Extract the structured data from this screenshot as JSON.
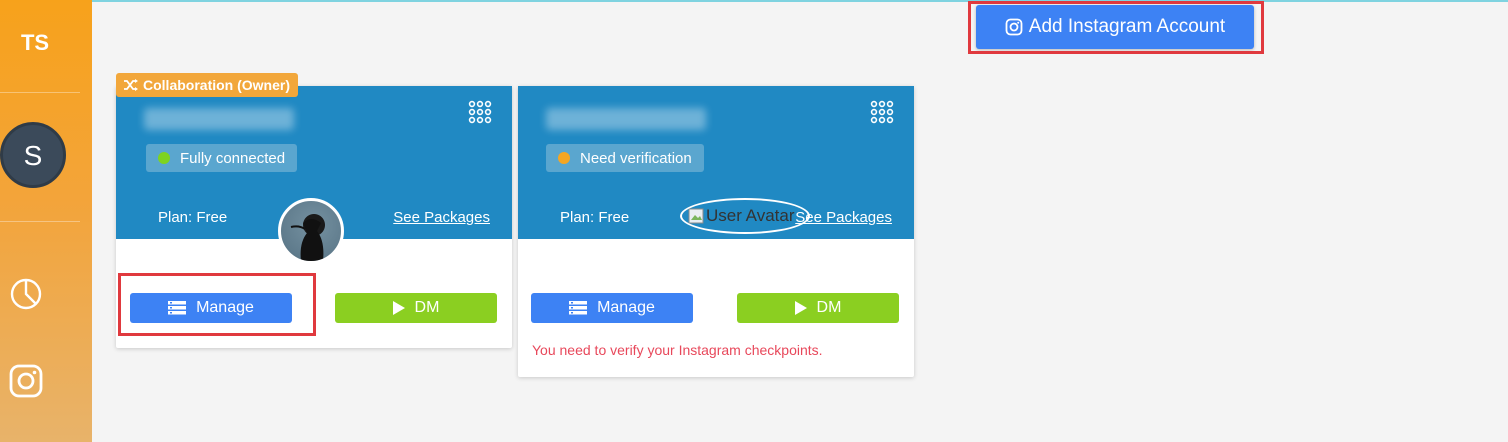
{
  "sidebar": {
    "initials": "TS",
    "avatar_letter": "S",
    "items": [
      {
        "icon": "pie-chart-icon"
      },
      {
        "icon": "instagram-icon"
      }
    ]
  },
  "header": {
    "add_account_label": "Add Instagram Account"
  },
  "accounts": [
    {
      "badge": "Collaboration (Owner)",
      "status": "Fully connected",
      "status_color": "#7ed321",
      "plan": "Plan: Free",
      "see_packages": "See Packages",
      "manage_label": "Manage",
      "dm_label": "DM"
    },
    {
      "status": "Need verification",
      "status_color": "#f5a623",
      "plan": "Plan: Free",
      "avatar_alt": "User Avatar",
      "see_packages": "See Packages",
      "manage_label": "Manage",
      "dm_label": "DM",
      "warning": "You need to verify your Instagram checkpoints."
    }
  ],
  "colors": {
    "sidebar": "#f7a21b",
    "card_header": "#2089c3",
    "primary": "#3d82f4",
    "success": "#8bcf21",
    "danger": "#e8485b"
  }
}
